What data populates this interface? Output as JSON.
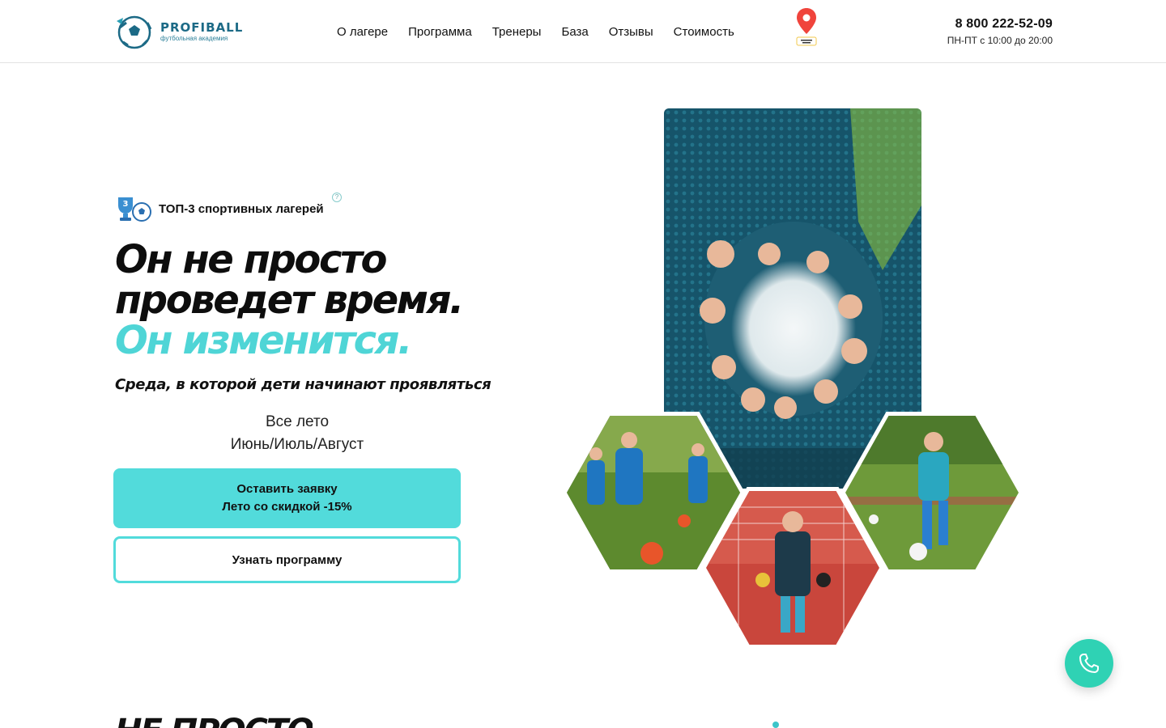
{
  "header": {
    "logo": {
      "name": "PROFIBALL",
      "subtitle": "футбольная академия"
    },
    "nav": [
      "О лагере",
      "Программа",
      "Тренеры",
      "База",
      "Отзывы",
      "Стоимость"
    ],
    "phone": "8 800 222-52-09",
    "hours": "ПН-ПТ с 10:00 до 20:00"
  },
  "hero": {
    "badge_number": "3",
    "badge_text": "ТОП-3 спортивных лагерей",
    "help_symbol": "?",
    "title_line1": "Он не просто",
    "title_line2": "проведет время.",
    "title_accent": "Он изменится.",
    "subtitle": "Среда, в которой дети начинают проявляться",
    "season_line1": "Все лето",
    "season_line2": "Июнь/Июль/Август",
    "primary_button_line1": "Оставить заявку",
    "primary_button_line2": "Лето со скидкой -15%",
    "secondary_button": "Узнать программу"
  },
  "next_section": {
    "title_fragment": "НЕ ПРОСТО"
  },
  "colors": {
    "accent": "#52dbdb",
    "call_button": "#2fd2b4",
    "brand": "#1c6a86"
  },
  "icons": {
    "call": "phone-icon",
    "map": "map-pin-icon",
    "badge": "trophy-ball-icon"
  }
}
